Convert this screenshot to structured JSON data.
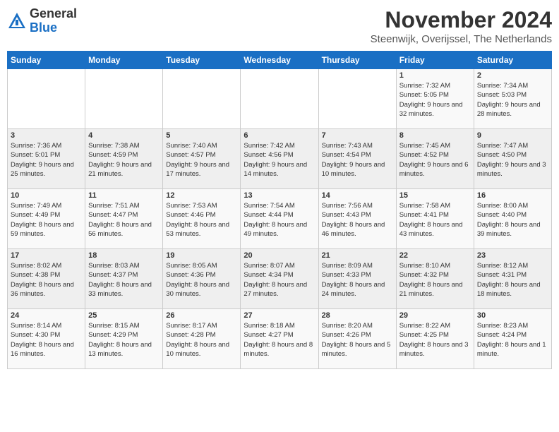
{
  "header": {
    "logo_general": "General",
    "logo_blue": "Blue",
    "title": "November 2024",
    "subtitle": "Steenwijk, Overijssel, The Netherlands"
  },
  "days_of_week": [
    "Sunday",
    "Monday",
    "Tuesday",
    "Wednesday",
    "Thursday",
    "Friday",
    "Saturday"
  ],
  "weeks": [
    [
      {
        "day": "",
        "info": ""
      },
      {
        "day": "",
        "info": ""
      },
      {
        "day": "",
        "info": ""
      },
      {
        "day": "",
        "info": ""
      },
      {
        "day": "",
        "info": ""
      },
      {
        "day": "1",
        "info": "Sunrise: 7:32 AM\nSunset: 5:05 PM\nDaylight: 9 hours and 32 minutes."
      },
      {
        "day": "2",
        "info": "Sunrise: 7:34 AM\nSunset: 5:03 PM\nDaylight: 9 hours and 28 minutes."
      }
    ],
    [
      {
        "day": "3",
        "info": "Sunrise: 7:36 AM\nSunset: 5:01 PM\nDaylight: 9 hours and 25 minutes."
      },
      {
        "day": "4",
        "info": "Sunrise: 7:38 AM\nSunset: 4:59 PM\nDaylight: 9 hours and 21 minutes."
      },
      {
        "day": "5",
        "info": "Sunrise: 7:40 AM\nSunset: 4:57 PM\nDaylight: 9 hours and 17 minutes."
      },
      {
        "day": "6",
        "info": "Sunrise: 7:42 AM\nSunset: 4:56 PM\nDaylight: 9 hours and 14 minutes."
      },
      {
        "day": "7",
        "info": "Sunrise: 7:43 AM\nSunset: 4:54 PM\nDaylight: 9 hours and 10 minutes."
      },
      {
        "day": "8",
        "info": "Sunrise: 7:45 AM\nSunset: 4:52 PM\nDaylight: 9 hours and 6 minutes."
      },
      {
        "day": "9",
        "info": "Sunrise: 7:47 AM\nSunset: 4:50 PM\nDaylight: 9 hours and 3 minutes."
      }
    ],
    [
      {
        "day": "10",
        "info": "Sunrise: 7:49 AM\nSunset: 4:49 PM\nDaylight: 8 hours and 59 minutes."
      },
      {
        "day": "11",
        "info": "Sunrise: 7:51 AM\nSunset: 4:47 PM\nDaylight: 8 hours and 56 minutes."
      },
      {
        "day": "12",
        "info": "Sunrise: 7:53 AM\nSunset: 4:46 PM\nDaylight: 8 hours and 53 minutes."
      },
      {
        "day": "13",
        "info": "Sunrise: 7:54 AM\nSunset: 4:44 PM\nDaylight: 8 hours and 49 minutes."
      },
      {
        "day": "14",
        "info": "Sunrise: 7:56 AM\nSunset: 4:43 PM\nDaylight: 8 hours and 46 minutes."
      },
      {
        "day": "15",
        "info": "Sunrise: 7:58 AM\nSunset: 4:41 PM\nDaylight: 8 hours and 43 minutes."
      },
      {
        "day": "16",
        "info": "Sunrise: 8:00 AM\nSunset: 4:40 PM\nDaylight: 8 hours and 39 minutes."
      }
    ],
    [
      {
        "day": "17",
        "info": "Sunrise: 8:02 AM\nSunset: 4:38 PM\nDaylight: 8 hours and 36 minutes."
      },
      {
        "day": "18",
        "info": "Sunrise: 8:03 AM\nSunset: 4:37 PM\nDaylight: 8 hours and 33 minutes."
      },
      {
        "day": "19",
        "info": "Sunrise: 8:05 AM\nSunset: 4:36 PM\nDaylight: 8 hours and 30 minutes."
      },
      {
        "day": "20",
        "info": "Sunrise: 8:07 AM\nSunset: 4:34 PM\nDaylight: 8 hours and 27 minutes."
      },
      {
        "day": "21",
        "info": "Sunrise: 8:09 AM\nSunset: 4:33 PM\nDaylight: 8 hours and 24 minutes."
      },
      {
        "day": "22",
        "info": "Sunrise: 8:10 AM\nSunset: 4:32 PM\nDaylight: 8 hours and 21 minutes."
      },
      {
        "day": "23",
        "info": "Sunrise: 8:12 AM\nSunset: 4:31 PM\nDaylight: 8 hours and 18 minutes."
      }
    ],
    [
      {
        "day": "24",
        "info": "Sunrise: 8:14 AM\nSunset: 4:30 PM\nDaylight: 8 hours and 16 minutes."
      },
      {
        "day": "25",
        "info": "Sunrise: 8:15 AM\nSunset: 4:29 PM\nDaylight: 8 hours and 13 minutes."
      },
      {
        "day": "26",
        "info": "Sunrise: 8:17 AM\nSunset: 4:28 PM\nDaylight: 8 hours and 10 minutes."
      },
      {
        "day": "27",
        "info": "Sunrise: 8:18 AM\nSunset: 4:27 PM\nDaylight: 8 hours and 8 minutes."
      },
      {
        "day": "28",
        "info": "Sunrise: 8:20 AM\nSunset: 4:26 PM\nDaylight: 8 hours and 5 minutes."
      },
      {
        "day": "29",
        "info": "Sunrise: 8:22 AM\nSunset: 4:25 PM\nDaylight: 8 hours and 3 minutes."
      },
      {
        "day": "30",
        "info": "Sunrise: 8:23 AM\nSunset: 4:24 PM\nDaylight: 8 hours and 1 minute."
      }
    ]
  ]
}
